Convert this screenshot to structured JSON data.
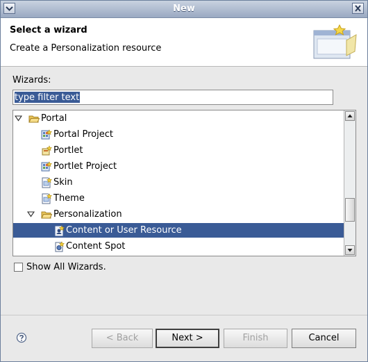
{
  "window": {
    "title": "New"
  },
  "header": {
    "title": "Select a wizard",
    "description": "Create a Personalization resource"
  },
  "wizards_label": "Wizards:",
  "filter": {
    "value": "type filter text"
  },
  "tree": [
    {
      "label": "Portal",
      "level": 0,
      "kind": "folder-open",
      "expanded": true
    },
    {
      "label": "Portal Project",
      "level": 1,
      "kind": "project"
    },
    {
      "label": "Portlet",
      "level": 1,
      "kind": "portlet"
    },
    {
      "label": "Portlet Project",
      "level": 1,
      "kind": "project"
    },
    {
      "label": "Skin",
      "level": 1,
      "kind": "file"
    },
    {
      "label": "Theme",
      "level": 1,
      "kind": "file"
    },
    {
      "label": "Personalization",
      "level": 1,
      "kind": "folder-open",
      "expanded": true
    },
    {
      "label": "Content or User Resource",
      "level": 2,
      "kind": "resource",
      "selected": true
    },
    {
      "label": "Content Spot",
      "level": 2,
      "kind": "spot"
    }
  ],
  "show_all": {
    "label": "Show All Wizards.",
    "checked": false
  },
  "buttons": {
    "back": "< Back",
    "next": "Next >",
    "finish": "Finish",
    "cancel": "Cancel"
  },
  "colors": {
    "selection": "#3a5b96",
    "titlebar": "#9aa9c2"
  }
}
